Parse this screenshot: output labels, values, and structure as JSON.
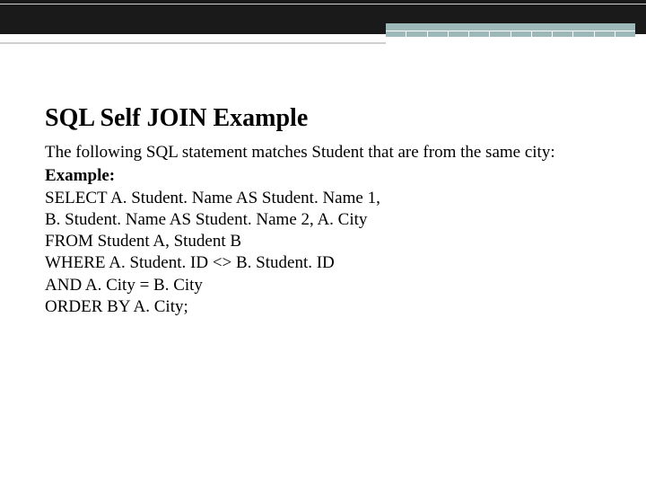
{
  "title": "SQL Self JOIN Example",
  "intro": "The following SQL statement matches Student that are from the same city:",
  "label": "Example:",
  "code": {
    "l1": "SELECT A. Student. Name AS Student. Name 1,",
    "l2": "B. Student. Name AS Student. Name 2, A. City",
    "l3": "FROM Student A, Student B",
    "l4": "WHERE A. Student. ID <> B. Student. ID",
    "l5": "AND A. City = B. City",
    "l6": "ORDER BY A. City;"
  }
}
